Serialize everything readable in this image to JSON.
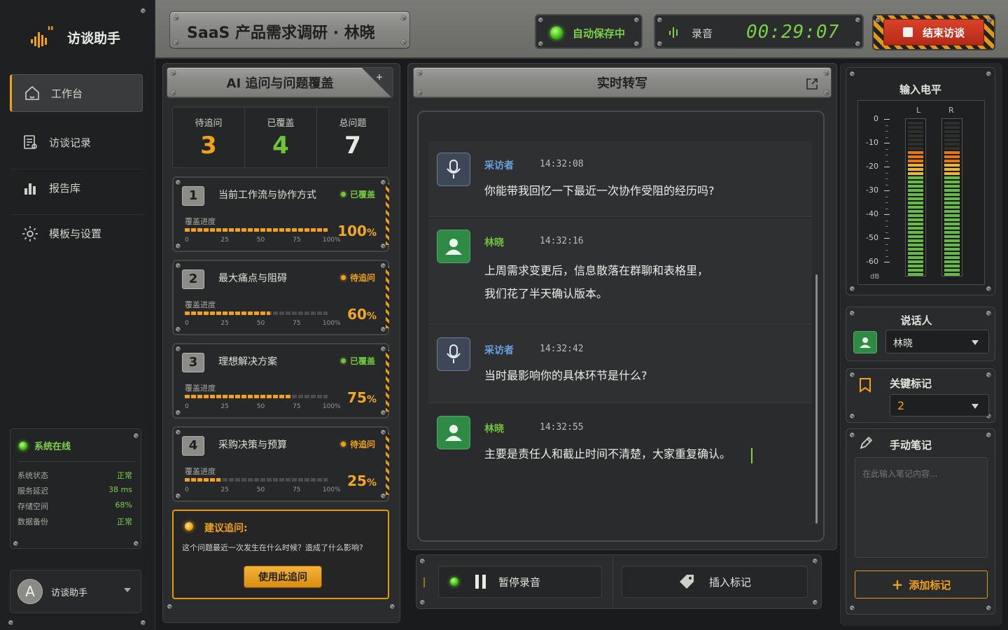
{
  "app": {
    "name": "访谈助手"
  },
  "sidebar": {
    "items": [
      {
        "label": "工作台",
        "icon": "home-icon",
        "active": true
      },
      {
        "label": "访谈记录",
        "icon": "document-icon"
      },
      {
        "label": "报告库",
        "icon": "bar-chart-icon"
      },
      {
        "label": "模板与设置",
        "icon": "gear-icon"
      }
    ],
    "status": {
      "title": "系统在线",
      "rows": [
        {
          "k": "系统状态",
          "v": "正常"
        },
        {
          "k": "服务延迟",
          "v": "38 ms"
        },
        {
          "k": "存储空间",
          "v": "68%"
        },
        {
          "k": "数据备份",
          "v": "正常"
        }
      ]
    },
    "user": {
      "initial": "A",
      "name": "访谈助手"
    }
  },
  "header": {
    "title": "SaaS 产品需求调研 · 林晓",
    "autosave": "自动保存中",
    "recording_label": "录音",
    "timer": "00:29:07",
    "end_button": "结束访谈"
  },
  "coverage": {
    "title": "AI 追问与问题覆盖",
    "stats": [
      {
        "label": "待追问",
        "value": "3",
        "color": "#f0a21a"
      },
      {
        "label": "已覆盖",
        "value": "4",
        "color": "#6fc43c"
      },
      {
        "label": "总问题",
        "value": "7",
        "color": "#e8e8e4"
      }
    ],
    "progress_label": "覆盖进度",
    "ticks": [
      "0",
      "25",
      "50",
      "75",
      "100%"
    ],
    "questions": [
      {
        "num": "1",
        "title": "当前工作流与协作方式",
        "status": "已覆盖",
        "progress": 100,
        "pct": "100",
        "done": true
      },
      {
        "num": "2",
        "title": "最大痛点与阻碍",
        "status": "待追问",
        "progress": 60,
        "pct": "60",
        "done": false
      },
      {
        "num": "3",
        "title": "理想解决方案",
        "status": "已覆盖",
        "progress": 75,
        "pct": "75",
        "done": true
      },
      {
        "num": "4",
        "title": "采购决策与预算",
        "status": "待追问",
        "progress": 25,
        "pct": "25",
        "done": false
      }
    ],
    "suggestion": {
      "title": "建议追问:",
      "text": "这个问题最近一次发生在什么时候？造成了什么影响?",
      "button": "使用此追问"
    }
  },
  "transcript": {
    "title": "实时转写",
    "messages": [
      {
        "speaker": "采访者",
        "time": "14:32:08",
        "lines": [
          "你能带我回忆一下最近一次协作受阻的经历吗?"
        ],
        "role": "interviewer"
      },
      {
        "speaker": "林晓",
        "time": "14:32:16",
        "lines": [
          "上周需求变更后，信息散落在群聊和表格里，",
          "我们花了半天确认版本。"
        ],
        "role": "interviewee"
      },
      {
        "speaker": "采访者",
        "time": "14:32:42",
        "lines": [
          "当时最影响你的具体环节是什么?"
        ],
        "role": "interviewer"
      },
      {
        "speaker": "林晓",
        "time": "14:32:55",
        "lines": [
          "主要是责任人和截止时间不清楚，大家重复确认。"
        ],
        "role": "interviewee"
      }
    ],
    "pause_button": "暂停录音",
    "mark_button": "插入标记"
  },
  "meter": {
    "title": "输入电平",
    "channels": [
      "L",
      "R"
    ],
    "scale": [
      "0",
      "-10",
      "-20",
      "-30",
      "-40",
      "-50",
      "-60"
    ],
    "unit": "dB",
    "level_L": 0.82,
    "level_R": 0.82
  },
  "speaker": {
    "title": "说话人",
    "value": "林晓"
  },
  "keymark": {
    "title": "关键标记",
    "value": "2"
  },
  "notes": {
    "title": "手动笔记",
    "placeholder": "在此输入笔记内容...",
    "add_button": "添加标记"
  },
  "colors": {
    "accent": "#f0a21a",
    "green": "#6fc43c",
    "blue": "#6aa0e0",
    "red": "#c8321f"
  }
}
